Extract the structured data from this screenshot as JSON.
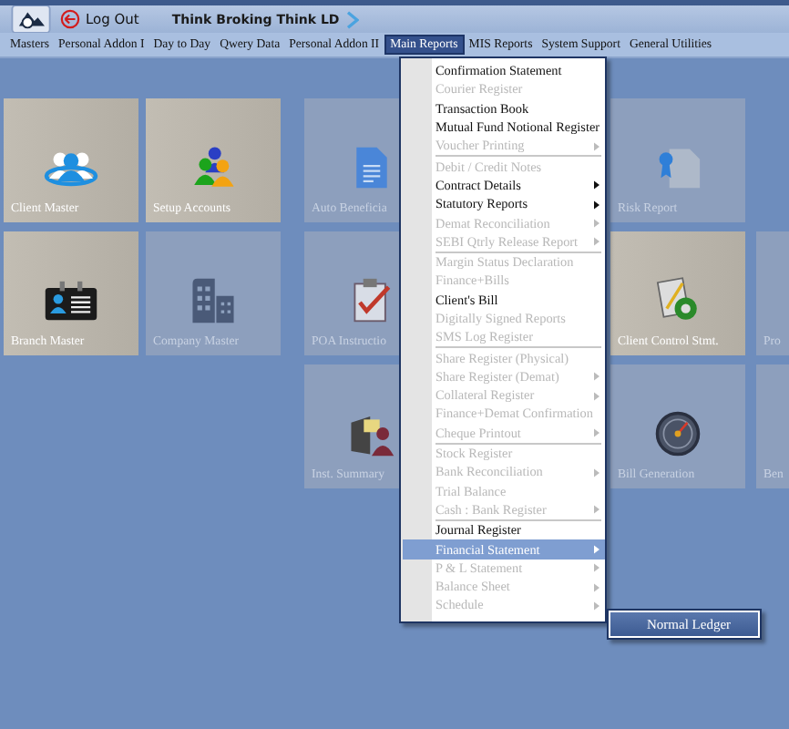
{
  "header": {
    "logout": "Log Out",
    "company": "Think Broking Think LD"
  },
  "menubar": [
    {
      "label": "Masters",
      "selected": false
    },
    {
      "label": "Personal Addon I",
      "selected": false
    },
    {
      "label": "Day to Day",
      "selected": false
    },
    {
      "label": "Qwery Data",
      "selected": false
    },
    {
      "label": "Personal Addon II",
      "selected": false
    },
    {
      "label": "Main Reports",
      "selected": true
    },
    {
      "label": "MIS Reports",
      "selected": false
    },
    {
      "label": "System Support",
      "selected": false
    },
    {
      "label": "General Utilities",
      "selected": false
    }
  ],
  "tile_rows": [
    [
      {
        "kind": "tile",
        "label": "Client Master",
        "active": true
      },
      {
        "kind": "tile",
        "label": "Setup Accounts",
        "active": true
      },
      {
        "kind": "tile",
        "label": "Auto Beneficia",
        "active": false
      },
      {
        "kind": "hidden"
      },
      {
        "kind": "tile",
        "label": "Risk Report",
        "active": false
      },
      {
        "kind": "blank"
      }
    ],
    [
      {
        "kind": "tile",
        "label": "Branch Master",
        "active": true
      },
      {
        "kind": "tile",
        "label": "Company Master",
        "active": false
      },
      {
        "kind": "tile",
        "label": "POA Instructio",
        "active": false
      },
      {
        "kind": "hidden"
      },
      {
        "kind": "tile",
        "label": "Client Control Stmt.",
        "active": true
      },
      {
        "kind": "tile",
        "label": "Pro",
        "active": false
      }
    ],
    [
      {
        "kind": "blank"
      },
      {
        "kind": "blank"
      },
      {
        "kind": "tile",
        "label": "Inst. Summary",
        "active": false
      },
      {
        "kind": "hidden"
      },
      {
        "kind": "tile",
        "label": "Bill Generation",
        "active": false
      },
      {
        "kind": "tile",
        "label": "Ben",
        "active": false
      }
    ]
  ],
  "dropdown": [
    {
      "kind": "item",
      "label": "Confirmation Statement",
      "disabled": false,
      "submenu": false,
      "selected": false
    },
    {
      "kind": "item",
      "label": "Courier Register",
      "disabled": true,
      "submenu": false,
      "selected": false
    },
    {
      "kind": "item",
      "label": "Transaction Book",
      "disabled": false,
      "submenu": false,
      "selected": false
    },
    {
      "kind": "item",
      "label": "Mutual Fund Notional Register",
      "disabled": false,
      "submenu": false,
      "selected": false
    },
    {
      "kind": "item",
      "label": "Voucher Printing",
      "disabled": true,
      "submenu": true,
      "selected": false
    },
    {
      "kind": "separator"
    },
    {
      "kind": "item",
      "label": "Debit / Credit Notes",
      "disabled": true,
      "submenu": false,
      "selected": false
    },
    {
      "kind": "item",
      "label": "Contract Details",
      "disabled": false,
      "submenu": true,
      "selected": false
    },
    {
      "kind": "item",
      "label": "Statutory Reports",
      "disabled": false,
      "submenu": true,
      "selected": false
    },
    {
      "kind": "item",
      "label": "Demat Reconciliation",
      "disabled": true,
      "submenu": true,
      "selected": false
    },
    {
      "kind": "item",
      "label": "SEBI Qtrly Release Report",
      "disabled": true,
      "submenu": true,
      "selected": false
    },
    {
      "kind": "separator"
    },
    {
      "kind": "item",
      "label": "Margin Status Declaration",
      "disabled": true,
      "submenu": false,
      "selected": false
    },
    {
      "kind": "item",
      "label": "Finance+Bills",
      "disabled": true,
      "submenu": false,
      "selected": false
    },
    {
      "kind": "item",
      "label": "Client's Bill",
      "disabled": false,
      "submenu": false,
      "selected": false
    },
    {
      "kind": "item",
      "label": "Digitally Signed Reports",
      "disabled": true,
      "submenu": false,
      "selected": false
    },
    {
      "kind": "item",
      "label": "SMS Log Register",
      "disabled": true,
      "submenu": false,
      "selected": false
    },
    {
      "kind": "separator"
    },
    {
      "kind": "item",
      "label": "Share Register (Physical)",
      "disabled": true,
      "submenu": false,
      "selected": false
    },
    {
      "kind": "item",
      "label": "Share Register (Demat)",
      "disabled": true,
      "submenu": true,
      "selected": false
    },
    {
      "kind": "item",
      "label": "Collateral Register",
      "disabled": true,
      "submenu": true,
      "selected": false
    },
    {
      "kind": "item",
      "label": "Finance+Demat Confirmation",
      "disabled": true,
      "submenu": false,
      "selected": false
    },
    {
      "kind": "item",
      "label": "Cheque Printout",
      "disabled": true,
      "submenu": true,
      "selected": false
    },
    {
      "kind": "separator"
    },
    {
      "kind": "item",
      "label": "Stock Register",
      "disabled": true,
      "submenu": false,
      "selected": false
    },
    {
      "kind": "item",
      "label": "Bank Reconciliation",
      "disabled": true,
      "submenu": true,
      "selected": false
    },
    {
      "kind": "item",
      "label": "Trial Balance",
      "disabled": true,
      "submenu": false,
      "selected": false
    },
    {
      "kind": "item",
      "label": "Cash : Bank Register",
      "disabled": true,
      "submenu": true,
      "selected": false
    },
    {
      "kind": "separator"
    },
    {
      "kind": "item",
      "label": "Journal Register",
      "disabled": false,
      "submenu": false,
      "selected": false
    },
    {
      "kind": "item",
      "label": "Financial Statement",
      "disabled": false,
      "submenu": true,
      "selected": true
    },
    {
      "kind": "item",
      "label": "P & L Statement",
      "disabled": true,
      "submenu": true,
      "selected": false
    },
    {
      "kind": "item",
      "label": "Balance Sheet",
      "disabled": true,
      "submenu": true,
      "selected": false
    },
    {
      "kind": "item",
      "label": "Schedule",
      "disabled": true,
      "submenu": true,
      "selected": false
    }
  ],
  "submenu": [
    {
      "label": "Normal Ledger",
      "selected": true
    }
  ]
}
